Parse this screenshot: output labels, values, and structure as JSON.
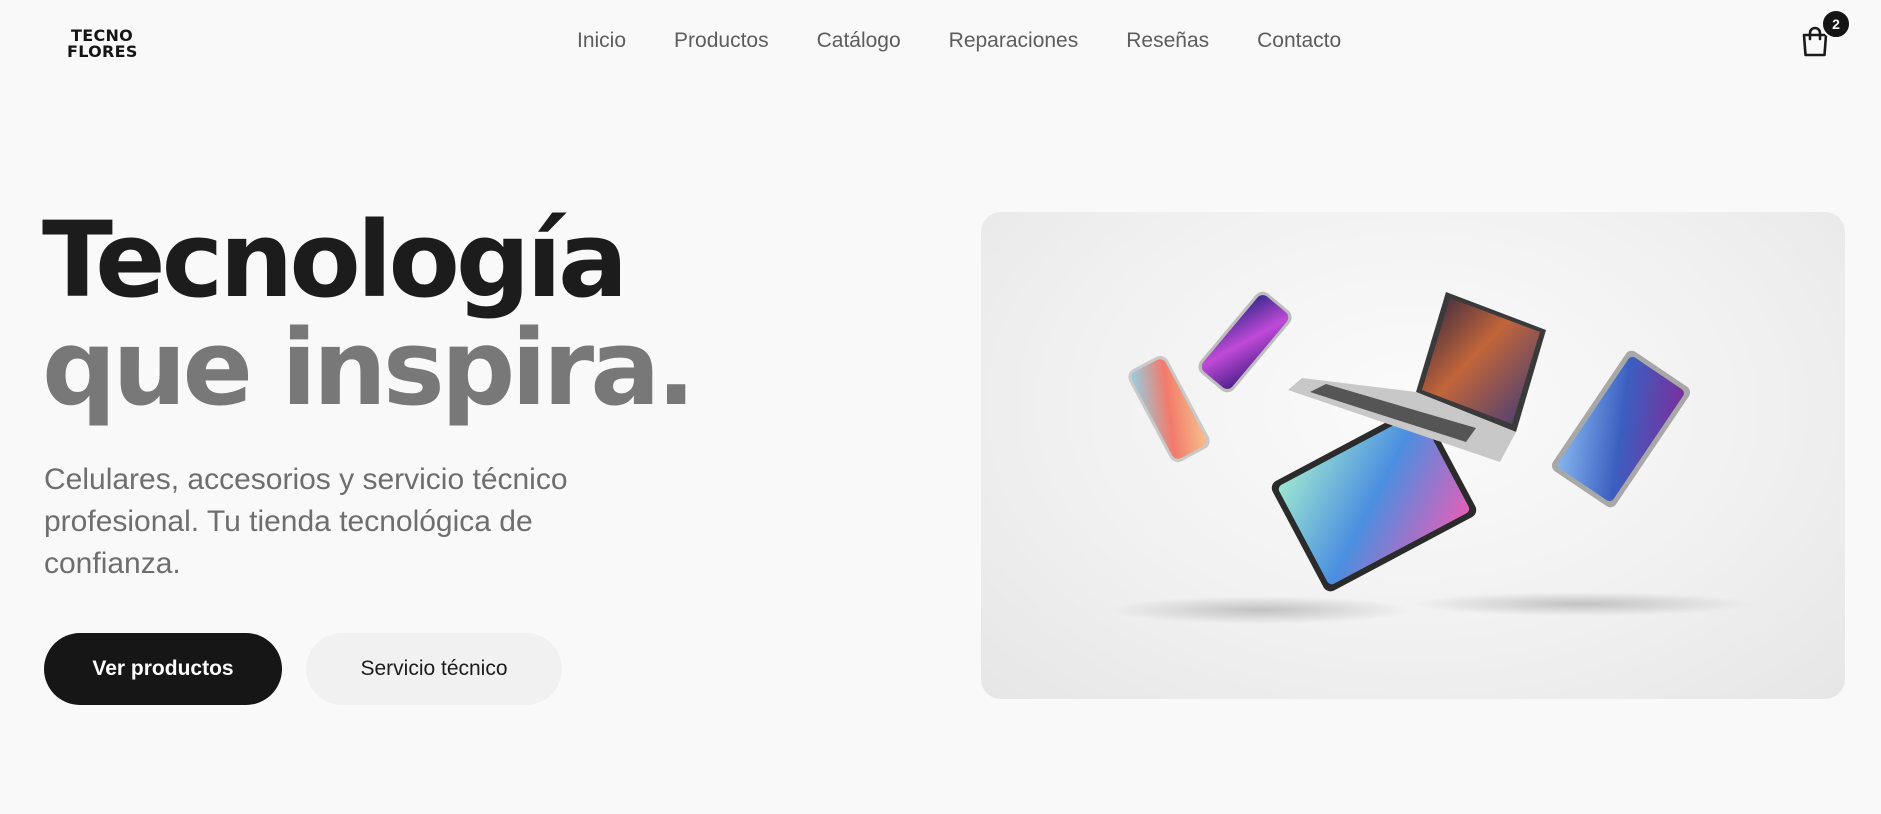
{
  "brand": {
    "line1": "TECNO",
    "line2": "FLORES"
  },
  "nav": {
    "items": [
      {
        "label": "Inicio"
      },
      {
        "label": "Productos"
      },
      {
        "label": "Catálogo"
      },
      {
        "label": "Reparaciones"
      },
      {
        "label": "Reseñas"
      },
      {
        "label": "Contacto"
      }
    ]
  },
  "cart": {
    "count": "2",
    "icon": "shopping-bag-icon"
  },
  "hero": {
    "title_line1": "Tecnología",
    "title_line2": "que inspira.",
    "subtitle": "Celulares, accesorios y servicio técnico profesional. Tu tienda tecnológica de confianza.",
    "primary_button": "Ver productos",
    "secondary_button": "Servicio técnico"
  },
  "colors": {
    "primary": "#161616",
    "background": "#f9f9f9",
    "muted_text": "#787878"
  }
}
